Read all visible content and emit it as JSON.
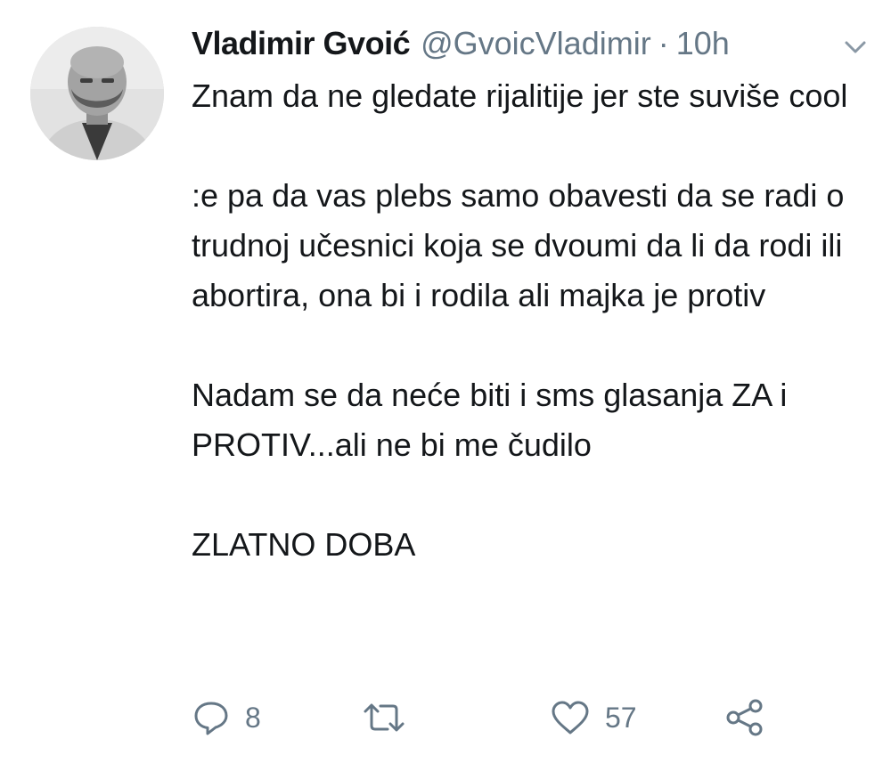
{
  "tweet": {
    "author": {
      "display_name": "Vladimir Gvoić",
      "handle": "@GvoicVladimir",
      "avatar_icon": "profile-photo"
    },
    "separator": "·",
    "time": "10h",
    "menu_icon": "chevron-down-icon",
    "paragraphs": [
      "Znam da ne gledate rijalitije jer ste suviše cool",
      ":e pa da vas plebs samo obavesti da se radi o trudnoj učesnici koja se dvoumi da li da rodi ili abortira, ona bi i rodila ali majka je protiv",
      "Nadam se da neće biti i sms glasanja ZA i PROTIV...ali ne bi me čudilo",
      "ZLATNO DOBA"
    ],
    "actions": {
      "reply": {
        "icon": "reply-icon",
        "count": "8"
      },
      "retweet": {
        "icon": "retweet-icon"
      },
      "like": {
        "icon": "heart-icon",
        "count": "57"
      },
      "share": {
        "icon": "share-icon"
      }
    }
  },
  "colors": {
    "text": "#14171a",
    "secondary": "#657786",
    "background": "#ffffff"
  }
}
